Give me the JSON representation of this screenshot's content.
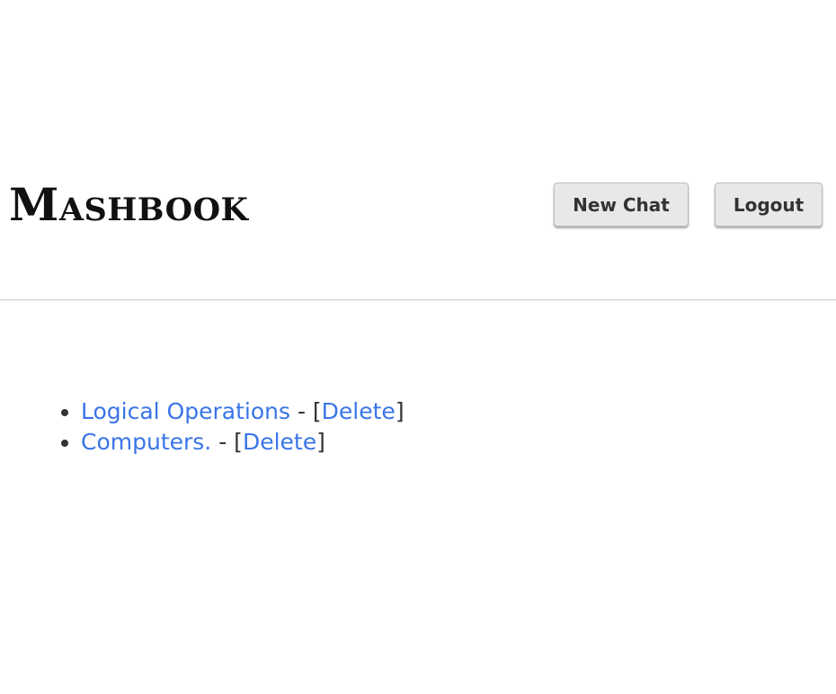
{
  "header": {
    "brand": "Mashbook",
    "new_chat_label": "New Chat",
    "logout_label": "Logout"
  },
  "chats": [
    {
      "title": "Logical Operations",
      "separator": " - [",
      "delete_label": "Delete",
      "close": "]"
    },
    {
      "title": "Computers.",
      "separator": " - [",
      "delete_label": "Delete",
      "close": "]"
    }
  ],
  "colors": {
    "link": "#3a75e6",
    "text": "#333333",
    "button_bg": "#e8e8e8",
    "divider": "#cccccc"
  }
}
